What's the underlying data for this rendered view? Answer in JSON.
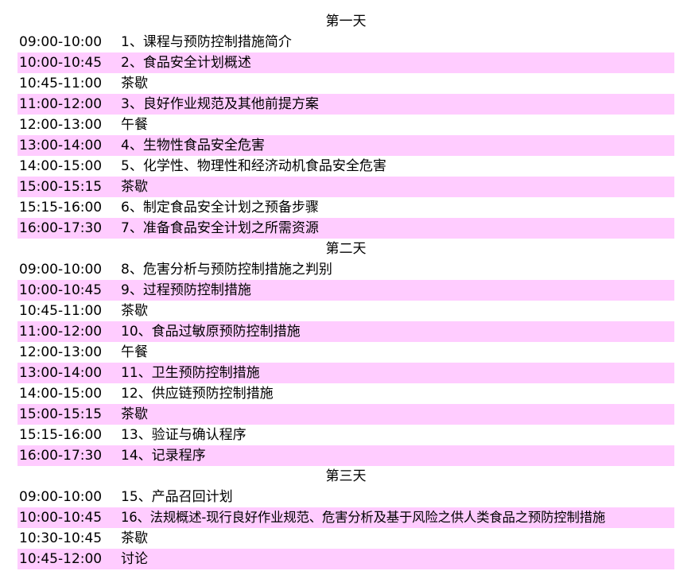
{
  "days": [
    {
      "title": "第一天",
      "rows": [
        {
          "time": "09:00-10:00",
          "topic": "1、课程与预防控制措施简介"
        },
        {
          "time": "10:00-10:45",
          "topic": "2、食品安全计划概述"
        },
        {
          "time": "10:45-11:00",
          "topic": "茶歇"
        },
        {
          "time": "11:00-12:00",
          "topic": "3、良好作业规范及其他前提方案"
        },
        {
          "time": "12:00-13:00",
          "topic": "午餐"
        },
        {
          "time": "13:00-14:00",
          "topic": "4、生物性食品安全危害"
        },
        {
          "time": "14:00-15:00",
          "topic": "5、化学性、物理性和经济动机食品安全危害"
        },
        {
          "time": "15:00-15:15",
          "topic": "茶歇"
        },
        {
          "time": "15:15-16:00",
          "topic": "6、制定食品安全计划之预备步骤"
        },
        {
          "time": "16:00-17:30",
          "topic": "7、准备食品安全计划之所需资源"
        }
      ]
    },
    {
      "title": "第二天",
      "rows": [
        {
          "time": "09:00-10:00",
          "topic": "8、危害分析与预防控制措施之判别"
        },
        {
          "time": "10:00-10:45",
          "topic": "9、过程预防控制措施"
        },
        {
          "time": "10:45-11:00",
          "topic": "茶歇"
        },
        {
          "time": "11:00-12:00",
          "topic": "10、食品过敏原预防控制措施"
        },
        {
          "time": "12:00-13:00",
          "topic": "午餐"
        },
        {
          "time": "13:00-14:00",
          "topic": "11、卫生预防控制措施"
        },
        {
          "time": "14:00-15:00",
          "topic": "12、供应链预防控制措施"
        },
        {
          "time": "15:00-15:15",
          "topic": "茶歇"
        },
        {
          "time": "15:15-16:00",
          "topic": "13、验证与确认程序"
        },
        {
          "time": "16:00-17:30",
          "topic": "14、记录程序"
        }
      ]
    },
    {
      "title": "第三天",
      "rows": [
        {
          "time": "09:00-10:00",
          "topic": "15、产品召回计划"
        },
        {
          "time": "10:00-10:45",
          "topic": "16、法规概述-现行良好作业规范、危害分析及基于风险之供人类食品之预防控制措施"
        },
        {
          "time": "10:30-10:45",
          "topic": "茶歇"
        },
        {
          "time": "10:45-12:00",
          "topic": "讨论"
        }
      ]
    }
  ],
  "colors": {
    "row_highlight": "#ffccff",
    "background": "#ffffff"
  }
}
